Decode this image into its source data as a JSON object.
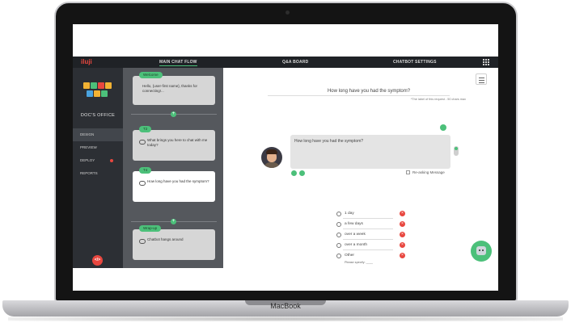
{
  "device": {
    "brand": "MacBook"
  },
  "app": {
    "logo": "iluji",
    "tabs": [
      "MAIN CHAT FLOW",
      "Q&A BOARD",
      "CHATBOT SETTINGS"
    ],
    "sidebar": {
      "title": "DOC'S OFFICE",
      "items": [
        {
          "label": "DESIGN"
        },
        {
          "label": "PREVIEW"
        },
        {
          "label": "DEPLOY"
        },
        {
          "label": "REPORTS"
        }
      ],
      "code_button": "</>"
    },
    "flow": {
      "cards": [
        {
          "tag": "Welcome",
          "text": "Hello, {user-first name}, thanks for connecting!..."
        },
        {
          "tag": "T2",
          "text": "What brings you here to chat with me today?"
        },
        {
          "tag": "T4",
          "text": "How long have you had the symptom?"
        },
        {
          "tag": "Wrap-up",
          "text": "Chatbot hangs around"
        }
      ]
    },
    "editor": {
      "question_label": "How long have you had the symptom?",
      "question_hint": "*The label of this request - 50 chars max",
      "message_text": "How long have you had the symptom?",
      "reasking_label": "Re-asking Message",
      "options": [
        "1 day",
        "a few days",
        "over a week",
        "over a month",
        "Other"
      ],
      "specify_label": "Please specify: ____"
    }
  }
}
